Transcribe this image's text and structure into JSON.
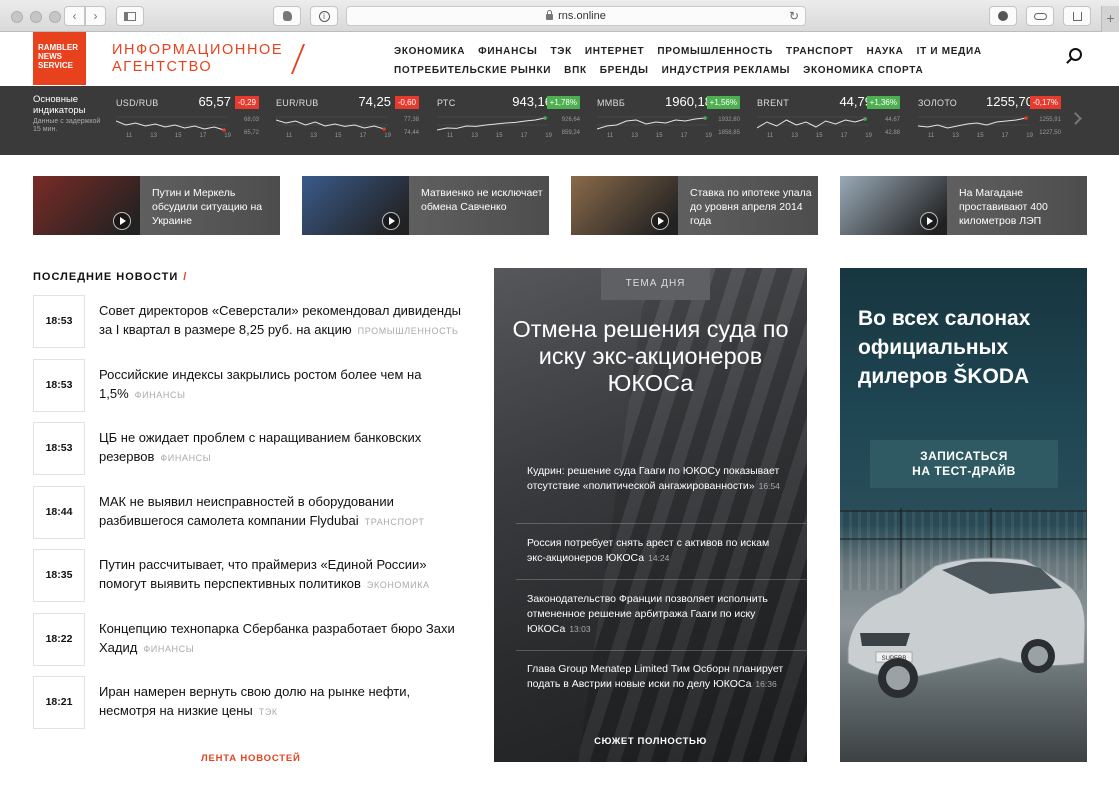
{
  "browser": {
    "url": "rns.online"
  },
  "header": {
    "logo_lines": [
      "RAMBLER",
      "NEWS",
      "SERVICE"
    ],
    "agency_lines": [
      "ИНФОРМАЦИОННОЕ",
      "АГЕНТСТВО"
    ],
    "nav_row1": [
      "ЭКОНОМИКА",
      "ФИНАНСЫ",
      "ТЭК",
      "ИНТЕРНЕТ",
      "ПРОМЫШЛЕННОСТЬ",
      "ТРАНСПОРТ",
      "НАУКА",
      "IT И МЕДИА"
    ],
    "nav_row2": [
      "ПОТРЕБИТЕЛЬСКИЕ РЫНКИ",
      "ВПК",
      "БРЕНДЫ",
      "ИНДУСТРИЯ РЕКЛАМЫ",
      "ЭКОНОМИКА СПОРТА"
    ]
  },
  "indicators": {
    "title": "Основные индикаторы",
    "subtitle": "Данные с задержкой 15 мин.",
    "x_ticks": [
      "11",
      "13",
      "15",
      "17",
      "19"
    ],
    "items": [
      {
        "name": "USD/RUB",
        "value": "65,57",
        "change": "-0,29",
        "dir": "neg",
        "high": "68,03",
        "low": "65,72",
        "points": [
          0.35,
          0.55,
          0.45,
          0.6,
          0.5,
          0.65,
          0.55,
          0.7,
          0.6,
          0.75,
          0.65,
          0.8
        ]
      },
      {
        "name": "EUR/RUB",
        "value": "74,25",
        "change": "-0,60",
        "dir": "neg",
        "high": "77,38",
        "low": "74,44",
        "points": [
          0.3,
          0.45,
          0.35,
          0.55,
          0.4,
          0.6,
          0.5,
          0.62,
          0.55,
          0.7,
          0.6,
          0.75
        ]
      },
      {
        "name": "РТС",
        "value": "943,16",
        "change": "+1,78%",
        "dir": "pos",
        "high": "926,64",
        "low": "859,24",
        "points": [
          0.8,
          0.7,
          0.72,
          0.6,
          0.62,
          0.55,
          0.5,
          0.45,
          0.42,
          0.35,
          0.3,
          0.2
        ]
      },
      {
        "name": "ММВБ",
        "value": "1960,18",
        "change": "+1,56%",
        "dir": "pos",
        "high": "1932,80",
        "low": "1858,85",
        "points": [
          0.75,
          0.6,
          0.55,
          0.35,
          0.3,
          0.5,
          0.4,
          0.45,
          0.3,
          0.35,
          0.25,
          0.2
        ]
      },
      {
        "name": "BRENT",
        "value": "44,79",
        "change": "+1,36%",
        "dir": "pos",
        "high": "44,67",
        "low": "42,88",
        "points": [
          0.7,
          0.4,
          0.6,
          0.3,
          0.55,
          0.4,
          0.65,
          0.35,
          0.5,
          0.3,
          0.4,
          0.25
        ]
      },
      {
        "name": "ЗОЛОТО",
        "value": "1255,70",
        "change": "-0,17%",
        "dir": "neg",
        "high": "1255,91",
        "low": "1227,50",
        "points": [
          0.6,
          0.65,
          0.55,
          0.7,
          0.6,
          0.5,
          0.45,
          0.55,
          0.4,
          0.35,
          0.3,
          0.2
        ]
      }
    ]
  },
  "cards": [
    {
      "title": "Путин и Меркель обсудили ситуацию на Украине",
      "bg": "#7a2b26"
    },
    {
      "title": "Матвиенко не исключает обмена Савченко",
      "bg": "#3a5a8a"
    },
    {
      "title": "Ставка по ипотеке упала до уровня апреля 2014 года",
      "bg": "#8a6a4a"
    },
    {
      "title": "На Магадане проставивают 400 километров ЛЭП",
      "bg": "#9aaab8"
    }
  ],
  "latest": {
    "title": "ПОСЛЕДНИЕ НОВОСТИ",
    "slash": "/",
    "more": "ЛЕНТА НОВОСТЕЙ",
    "items": [
      {
        "time": "18:53",
        "text": "Совет директоров «Северстали» рекомендовал дивиденды за I квартал в размере 8,25 руб. на акцию",
        "category": "ПРОМЫШЛЕННОСТЬ"
      },
      {
        "time": "18:53",
        "text": "Российские индексы закрылись ростом более чем на 1,5%",
        "category": "ФИНАНСЫ"
      },
      {
        "time": "18:53",
        "text": "ЦБ не ожидает проблем с наращиванием банковских резервов",
        "category": "ФИНАНСЫ"
      },
      {
        "time": "18:44",
        "text": "МАК не выявил неисправностей в оборудовании разбившегося самолета компании Flydubai",
        "category": "ТРАНСПОРТ"
      },
      {
        "time": "18:35",
        "text": "Путин рассчитывает, что праймериз «Единой России» помогут выявить перспективных политиков",
        "category": "ЭКОНОМИКА"
      },
      {
        "time": "18:22",
        "text": "Концепцию технопарка Сбербанка разработает бюро Захи Хадид",
        "category": "ФИНАНСЫ"
      },
      {
        "time": "18:21",
        "text": "Иран намерен вернуть свою долю на рынке нефти, несмотря на низкие цены",
        "category": "ТЭК"
      }
    ]
  },
  "theme": {
    "tag": "ТЕМА ДНЯ",
    "headline": "Отмена решения суда по иску экс-акционеров ЮКОСа",
    "items": [
      {
        "text": "Кудрин: решение суда Гааги по ЮКОСу показывает отсутствие «политической ангажированности»",
        "time": "16:54"
      },
      {
        "text": "Россия потребует снять арест с активов по искам экс-акционеров ЮКОСа",
        "time": "14:24"
      },
      {
        "text": "Законодательство Франции позволяет исполнить отмененное решение арбитража Гааги по иску ЮКОСа",
        "time": "13:03"
      },
      {
        "text": "Глава Group Menatep Limited Тим Осборн планирует подать в Австрии новые иски по делу ЮКОСа",
        "time": "16:36"
      }
    ],
    "all": "СЮЖЕТ ПОЛНОСТЬЮ"
  },
  "ad": {
    "headline": "Во всех салонах официальных дилеров ŠKODA",
    "cta_lines": [
      "ЗАПИСАТЬСЯ",
      "НА ТЕСТ-ДРАЙВ"
    ],
    "plate": "SUPERB"
  }
}
